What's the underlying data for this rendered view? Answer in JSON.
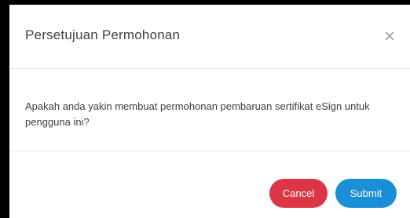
{
  "dialog": {
    "title": "Persetujuan Permohonan",
    "message": "Apakah anda yakin membuat permohonan pembaruan sertifikat eSign untuk pengguna ini?",
    "close_icon": "close-icon",
    "buttons": {
      "cancel_label": "Cancel",
      "submit_label": "Submit"
    }
  },
  "colors": {
    "cancel": "#dc3545",
    "submit": "#1a8fd7",
    "backdrop": "#000000",
    "text": "#3c4045"
  }
}
